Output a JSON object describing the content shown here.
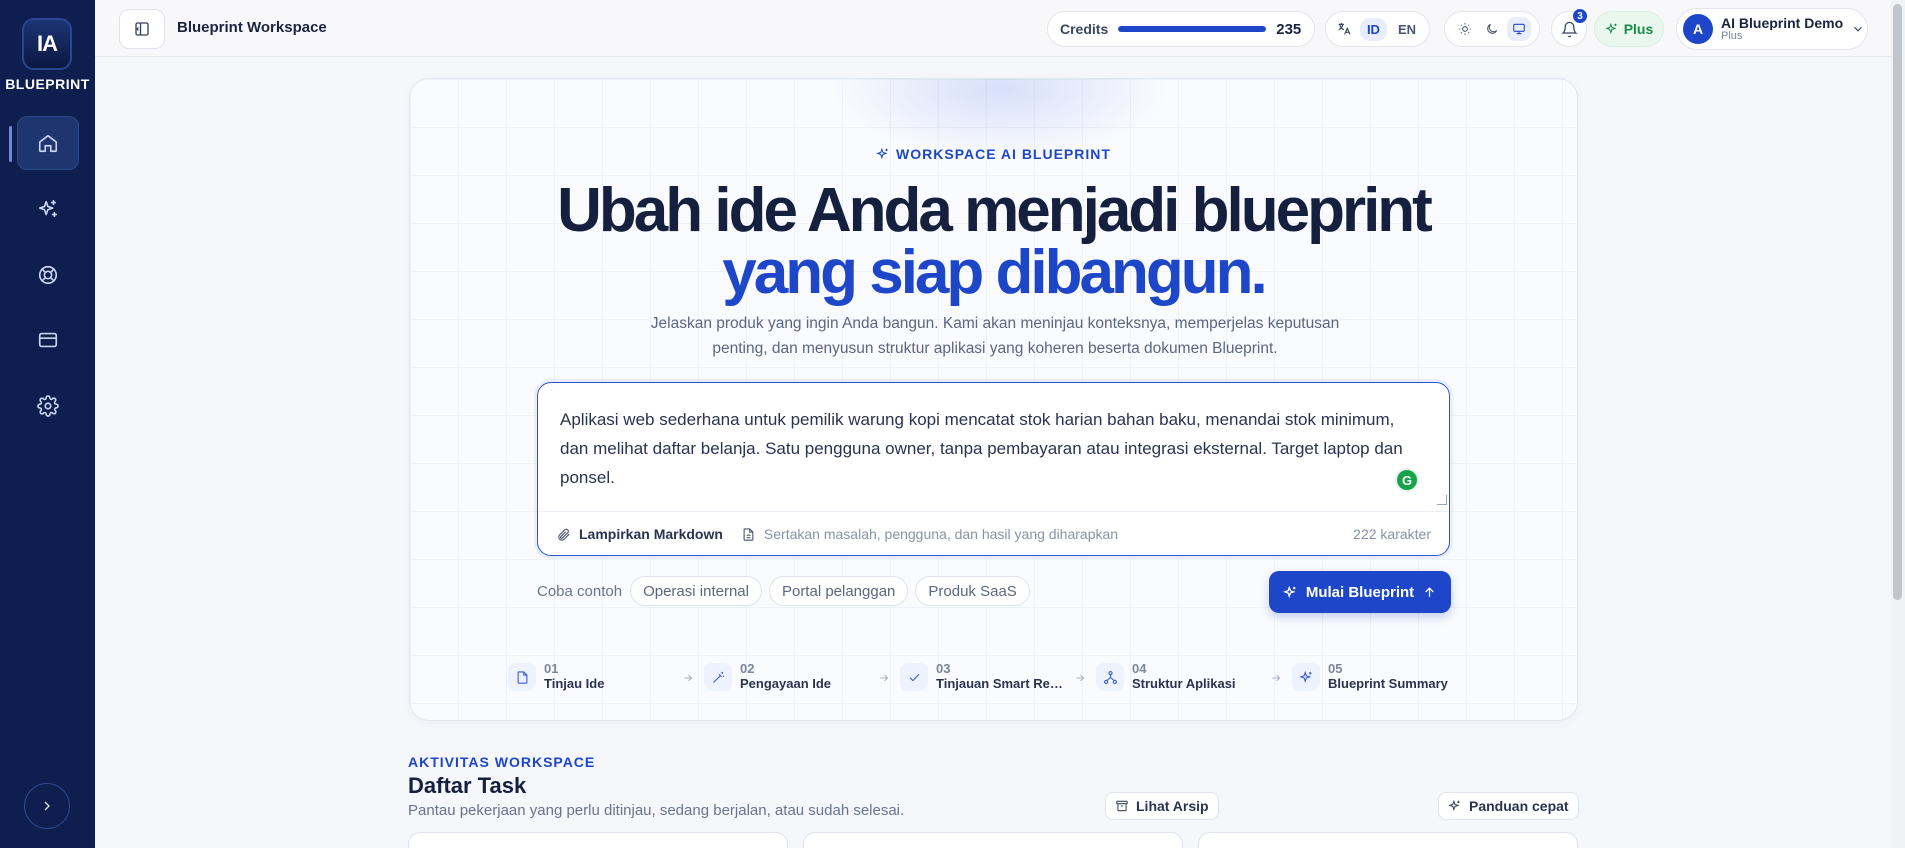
{
  "brand": {
    "logo_mark": "IA",
    "name": "BLUEPRINT"
  },
  "sidebar": {
    "items": [
      {
        "icon": "home-icon",
        "active": true
      },
      {
        "icon": "sparkles-icon",
        "active": false
      },
      {
        "icon": "lifebuoy-icon",
        "active": false
      },
      {
        "icon": "credit-card-icon",
        "active": false
      },
      {
        "icon": "gear-icon",
        "active": false
      }
    ],
    "expand_icon": "chevron-right-icon"
  },
  "topbar": {
    "title": "Blueprint Workspace",
    "credits": {
      "label": "Credits",
      "value": "235",
      "fill_percent": 100
    },
    "language": {
      "options": [
        "ID",
        "EN"
      ],
      "selected": "ID"
    },
    "theme": {
      "options": [
        "sun-icon",
        "moon-icon",
        "monitor-icon"
      ],
      "selected": "monitor-icon"
    },
    "notifications": {
      "count": "3"
    },
    "plan": {
      "label": "Plus"
    },
    "user": {
      "initial": "A",
      "name": "AI Blueprint Demo",
      "plan": "Plus"
    }
  },
  "hero": {
    "eyebrow": "WORKSPACE AI BLUEPRINT",
    "title_line1": "Ubah ide Anda menjadi blueprint",
    "title_line2": "yang siap dibangun.",
    "description": "Jelaskan produk yang ingin Anda bangun. Kami akan meninjau konteksnya, memperjelas keputusan penting, dan menyusun struktur aplikasi yang koheren beserta dokumen Blueprint.",
    "composer": {
      "value": "Aplikasi web sederhana untuk pemilik warung kopi mencatat stok harian bahan baku, menandai stok minimum, dan melihat daftar belanja. Satu pengguna owner, tanpa pembayaran atau integrasi eksternal. Target laptop dan ponsel.",
      "attach_label": "Lampirkan Markdown",
      "hint": "Sertakan masalah, pengguna, dan hasil yang diharapkan",
      "char_count": "222 karakter"
    },
    "examples": {
      "label": "Coba contoh",
      "chips": [
        "Operasi internal",
        "Portal pelanggan",
        "Produk SaaS"
      ]
    },
    "cta": "Mulai Blueprint",
    "steps": [
      {
        "num": "01",
        "name": "Tinjau Ide",
        "icon": "file-icon"
      },
      {
        "num": "02",
        "name": "Pengayaan Ide",
        "icon": "wand-icon"
      },
      {
        "num": "03",
        "name": "Tinjauan Smart Requirements",
        "icon": "check-icon"
      },
      {
        "num": "04",
        "name": "Struktur Aplikasi",
        "icon": "hierarchy-icon"
      },
      {
        "num": "05",
        "name": "Blueprint Summary",
        "icon": "sparkles-icon"
      }
    ]
  },
  "activity": {
    "eyebrow": "AKTIVITAS WORKSPACE",
    "title": "Daftar Task",
    "subtitle": "Pantau pekerjaan yang perlu ditinjau, sedang berjalan, atau sudah selesai.",
    "archive_label": "Lihat Arsip",
    "guide_label": "Panduan cepat"
  },
  "colors": {
    "sidebar": "#0d1e4f",
    "accent": "#1d47c8",
    "plan_green": "#1c8a4b"
  }
}
